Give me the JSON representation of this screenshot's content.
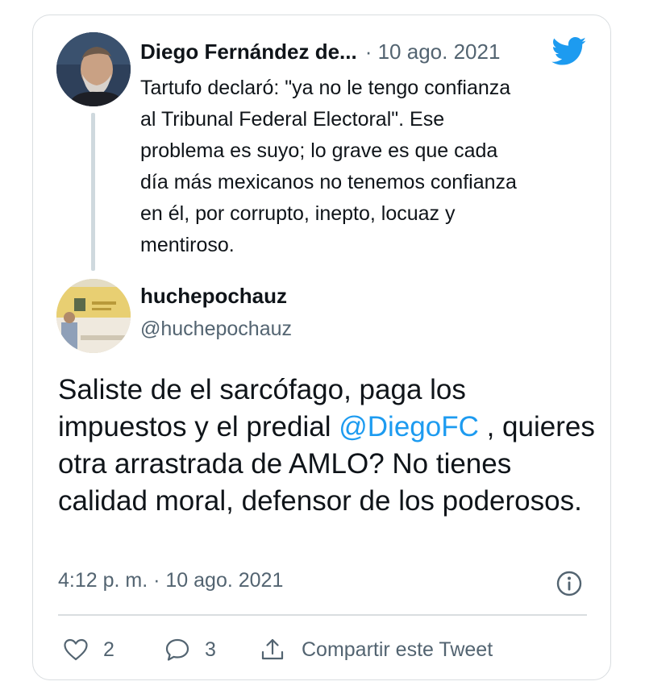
{
  "parent_tweet": {
    "author_name": "Diego Fernández de...",
    "date": "· 10 ago. 2021",
    "text": "Tartufo declaró: \"ya no le tengo confianza\nal Tribunal Federal Electoral\". Ese\nproblema es suyo; lo grave es que cada\ndía más mexicanos no tenemos confianza\nen él, por corrupto, inepto, locuaz y\nmentiroso."
  },
  "reply_tweet": {
    "author_name": "huchepochauz",
    "handle": "@huchepochauz",
    "text_before": "Saliste de el sarcófago, paga los impuestos y el predial ",
    "mention": "@DiegoFC",
    "text_after": " , quieres otra arrastrada de AMLO? No tienes calidad moral, defensor de los poderosos.",
    "timestamp": "4:12 p. m. · 10 ago. 2021"
  },
  "actions": {
    "likes": "2",
    "replies": "3",
    "share_label": "Compartir este Tweet"
  },
  "icons": {
    "brand": "twitter-bird",
    "info": "info-circle",
    "like": "heart-outline",
    "reply": "speech-bubble",
    "share": "share-arrow-up"
  },
  "colors": {
    "brand": "#1d9bf0",
    "text": "#0f1419",
    "secondary": "#536471",
    "border": "#d9dde0",
    "thread_line": "#cfd9de"
  }
}
